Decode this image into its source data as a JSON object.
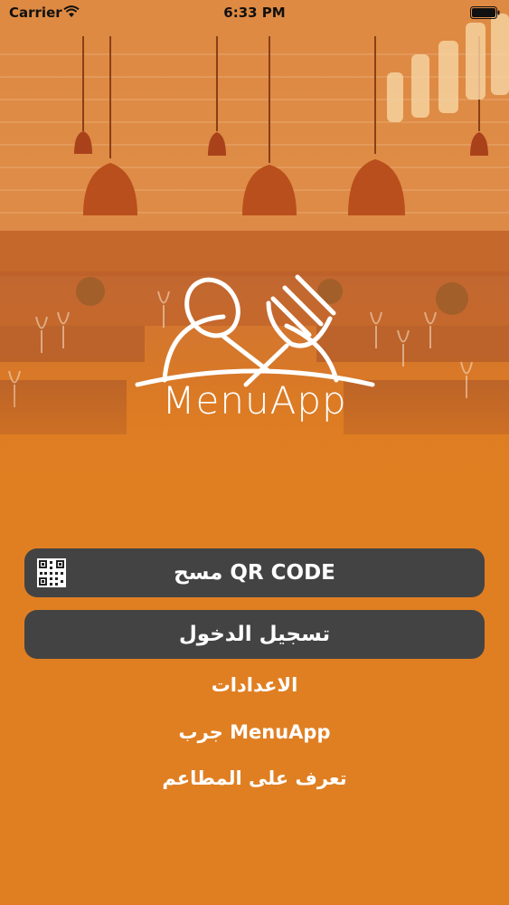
{
  "status_bar": {
    "carrier": "Carrier",
    "time": "6:33 PM"
  },
  "brand": {
    "name": "MenuApp"
  },
  "actions": {
    "scan_qr_label": "مسح QR CODE",
    "login_label": "تسجيل الدخول"
  },
  "links": {
    "settings": "الاعدادات",
    "try_app": "جرب MenuApp",
    "discover_restaurants": "تعرف على المطاعم"
  },
  "colors": {
    "background": "#e07f22",
    "button": "#434343",
    "text": "#ffffff"
  },
  "icons": {
    "qr": "qr-code-icon",
    "wifi": "wifi-icon",
    "battery": "battery-icon",
    "logo": "spoon-fork-dome-icon"
  }
}
